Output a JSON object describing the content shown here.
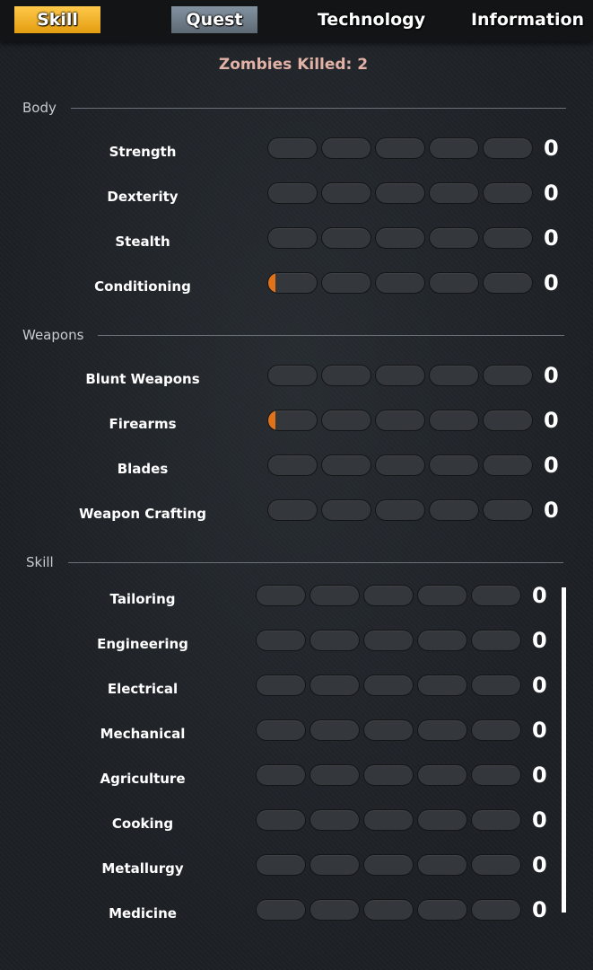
{
  "tabs": [
    {
      "label": "Skill",
      "active": true
    },
    {
      "label": "Quest",
      "active": false
    },
    {
      "label": "Technology",
      "active": false
    },
    {
      "label": "Information",
      "active": false
    }
  ],
  "zombies_killed": "Zombies Killed: 2",
  "colors": {
    "accent": "#f2b01e",
    "progress": "#e0731a",
    "kills_text": "#e3b2a6"
  },
  "sections": [
    {
      "title": "Body",
      "skills": [
        {
          "name": "Strength",
          "level": "0",
          "progress": 0
        },
        {
          "name": "Dexterity",
          "level": "0",
          "progress": 0
        },
        {
          "name": "Stealth",
          "level": "0",
          "progress": 0
        },
        {
          "name": "Conditioning",
          "level": "0",
          "progress": 0.03
        }
      ]
    },
    {
      "title": "Weapons",
      "skills": [
        {
          "name": "Blunt Weapons",
          "level": "0",
          "progress": 0
        },
        {
          "name": "Firearms",
          "level": "0",
          "progress": 0.03
        },
        {
          "name": "Blades",
          "level": "0",
          "progress": 0
        },
        {
          "name": "Weapon Crafting",
          "level": "0",
          "progress": 0
        }
      ]
    },
    {
      "title": "Skill",
      "skills": [
        {
          "name": "Tailoring",
          "level": "0",
          "progress": 0
        },
        {
          "name": "Engineering",
          "level": "0",
          "progress": 0
        },
        {
          "name": "Electrical",
          "level": "0",
          "progress": 0
        },
        {
          "name": "Mechanical",
          "level": "0",
          "progress": 0
        },
        {
          "name": "Agriculture",
          "level": "0",
          "progress": 0
        },
        {
          "name": "Cooking",
          "level": "0",
          "progress": 0
        },
        {
          "name": "Metallurgy",
          "level": "0",
          "progress": 0
        },
        {
          "name": "Medicine",
          "level": "0",
          "progress": 0
        }
      ]
    }
  ]
}
